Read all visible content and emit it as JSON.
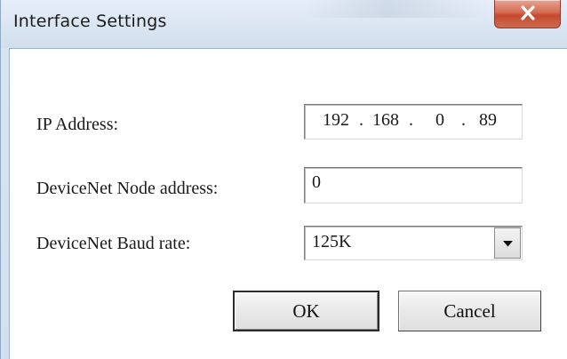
{
  "window": {
    "title": "Interface Settings",
    "close_icon": "close-icon"
  },
  "form": {
    "ip_label": "IP Address:",
    "ip_octets": [
      "192",
      "168",
      "0",
      "89"
    ],
    "ip_separator": ".",
    "node_label": "DeviceNet Node address:",
    "node_value": "0",
    "baud_label": "DeviceNet Baud rate:",
    "baud_value": "125K",
    "baud_arrow_icon": "chevron-down-icon"
  },
  "buttons": {
    "ok": "OK",
    "cancel": "Cancel"
  },
  "colors": {
    "title_bar": "#dde7f3",
    "close_button": "#d76a52",
    "client_bg": "#ffffff"
  }
}
